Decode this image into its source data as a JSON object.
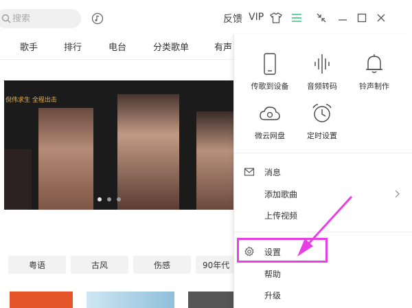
{
  "search": {
    "placeholder": "搜索"
  },
  "toolbar": {
    "feedback_label": "反馈",
    "vip_label": "VIP"
  },
  "nav": {
    "items": [
      "歌手",
      "排行",
      "电台",
      "分类歌单",
      "有声"
    ]
  },
  "banner": {
    "poster_text": "倪伟求生 全程出击"
  },
  "tags": [
    "粤语",
    "古风",
    "伤感",
    "90年代"
  ],
  "menu": {
    "grid": [
      {
        "label": "传歌到设备",
        "icon": "phone-icon"
      },
      {
        "label": "音频转码",
        "icon": "soundwave-icon"
      },
      {
        "label": "铃声制作",
        "icon": "bell-icon"
      },
      {
        "label": "微云网盘",
        "icon": "cloud-icon"
      },
      {
        "label": "定时设置",
        "icon": "alarm-clock-icon"
      }
    ],
    "messages_label": "消息",
    "add_song_label": "添加歌曲",
    "upload_video_label": "上传视频",
    "settings_label": "设置",
    "help_label": "帮助",
    "upgrade_label": "升级"
  },
  "colors": {
    "accent": "#31c27c",
    "annotation": "#e83fe5"
  }
}
